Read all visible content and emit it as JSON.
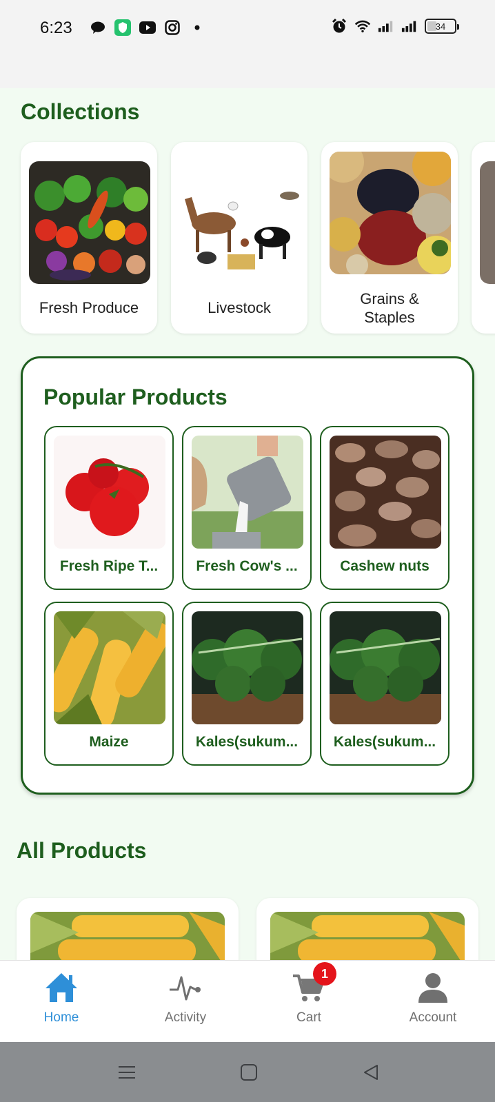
{
  "status_bar": {
    "time": "6:23",
    "battery": "34",
    "battery_fraction": 0.34,
    "left_icons": [
      "chat-icon",
      "vpn-shield-icon",
      "youtube-icon",
      "instagram-icon",
      "dot-icon"
    ],
    "right_icons": [
      "alarm-icon",
      "wifi-icon",
      "signal-icon",
      "signal-icon"
    ]
  },
  "collections": {
    "title": "Collections",
    "items": [
      {
        "label": "Fresh Produce",
        "image": "vegetables-image"
      },
      {
        "label": "Livestock",
        "image": "animals-image"
      },
      {
        "label": "Grains &\nStaples",
        "image": "grains-image"
      }
    ]
  },
  "popular": {
    "title": "Popular Products",
    "items": [
      {
        "label": "Fresh Ripe T...",
        "image": "tomatoes-image"
      },
      {
        "label": "Fresh Cow's ...",
        "image": "milk-image"
      },
      {
        "label": "Cashew nuts",
        "image": "cashew-image"
      },
      {
        "label": "Maize",
        "image": "maize-image"
      },
      {
        "label": "Kales(sukum...",
        "image": "kale-image"
      },
      {
        "label": "Kales(sukum...",
        "image": "kale-image"
      }
    ]
  },
  "all_products": {
    "title": "All Products"
  },
  "bottom_nav": {
    "items": [
      {
        "label": "Home",
        "icon": "home-icon",
        "active": true
      },
      {
        "label": "Activity",
        "icon": "activity-icon",
        "active": false
      },
      {
        "label": "Cart",
        "icon": "cart-icon",
        "active": false,
        "badge": "1"
      },
      {
        "label": "Account",
        "icon": "account-icon",
        "active": false
      }
    ]
  },
  "colors": {
    "brand_green": "#1e5e1e",
    "active_blue": "#2e8fd8",
    "badge_red": "#e4141b",
    "page_bg": "#f2fbf2"
  }
}
